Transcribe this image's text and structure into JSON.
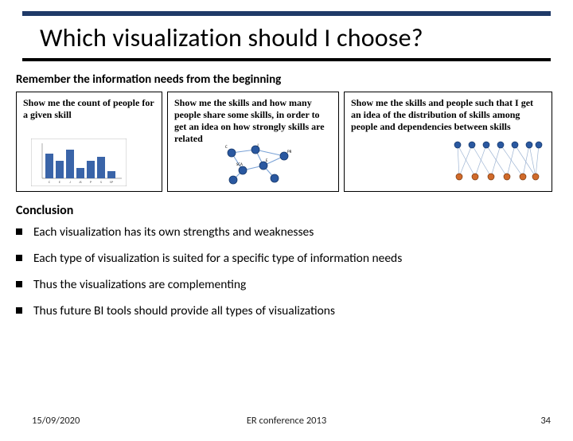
{
  "title": "Which visualization should I choose?",
  "section_remember": "Remember the information needs from the beginning",
  "cards": {
    "c1": "Show me the count of people for a given skill",
    "c2": "Show me the skills and how many people share some skills, in order to get an idea on how strongly skills are related",
    "c3": "Show me the skills and people such that I get an idea of the distribution of skills among people and dependencies between skills"
  },
  "section_conclusion": "Conclusion",
  "bullets": {
    "b1": "Each visualization has its own strengths and weaknesses",
    "b2": "Each type of visualization is suited for a specific type of information needs",
    "b3": "Thus the visualizations are complementing",
    "b4": "Thus future BI tools should provide all types of visualizations"
  },
  "footer": {
    "date": "15/09/2020",
    "venue": "ER conference 2013",
    "page": "34"
  },
  "chart_data": {
    "type": "bar",
    "categories": [
      "C",
      "E",
      "J",
      "JS",
      "P",
      "S",
      "SP"
    ],
    "values": [
      7,
      5,
      8,
      3,
      5,
      6,
      2
    ],
    "title": "",
    "xlabel": "",
    "ylabel": "",
    "ylim": [
      0,
      10
    ]
  }
}
